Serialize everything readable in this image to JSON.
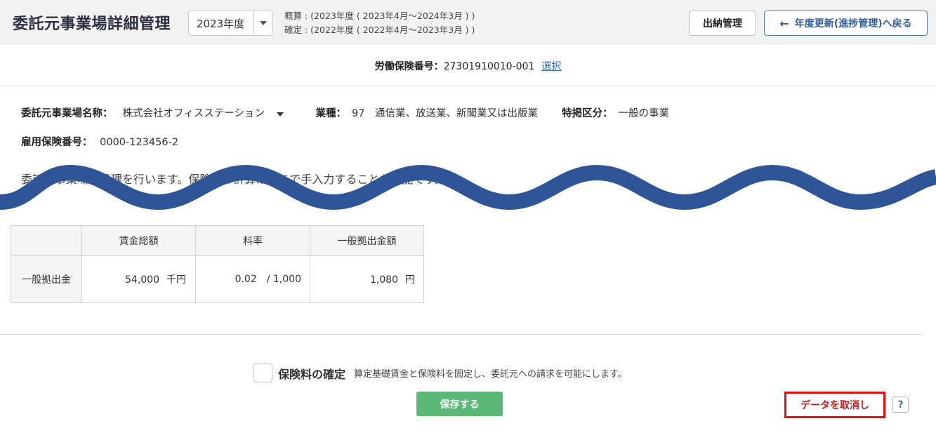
{
  "header": {
    "title": "委託元事業場詳細管理",
    "year_selected": "2023年度",
    "period_estimate": "概算 : (2023年度 ( 2023年4月～2024年3月 ) )",
    "period_confirmed": "確定 : (2022年度 ( 2022年4月～2023年3月 ) )",
    "deposit_button": "出納管理",
    "back_button": "年度更新(進捗管理)へ戻る",
    "back_icon": "arrow-left-icon"
  },
  "insurance_number": {
    "label": "労働保険番号：",
    "value": "27301910010-001",
    "select_link": "選択"
  },
  "info": {
    "client_name_label": "委託元事業場名称：",
    "client_name_value": "株式会社オフィスステーション",
    "industry_label": "業種：",
    "industry_value": "97　通信業、放送業、新聞業又は出版業",
    "special_label": "特掲区分：",
    "special_value": "一般の事業",
    "employment_no_label": "雇用保険番号：",
    "employment_no_value": "0000-123456-2"
  },
  "description": "委託元事業場の管理を行います。保険料の計算はここで手入力することも可能です。",
  "table": {
    "headers": [
      "",
      "賃金総額",
      "料率",
      "一般拠出金額"
    ],
    "row": {
      "label": "一般拠出金",
      "wage_value": "54,000",
      "wage_unit": "千円",
      "rate_value": "0.02",
      "rate_unit": "/ 1,000",
      "amount_value": "1,080",
      "amount_unit": "円"
    }
  },
  "confirm": {
    "label": "保険料の確定",
    "description": "算定基礎賃金と保険料を固定し、委託元への請求を可能にします。",
    "checked": false
  },
  "actions": {
    "save": "保存する",
    "cancel_data": "データを取消し",
    "help": "?"
  },
  "colors": {
    "wave": "#2e5597",
    "save_button": "#5cb876",
    "cancel_border": "#e01010",
    "link": "#2f6fc4"
  }
}
